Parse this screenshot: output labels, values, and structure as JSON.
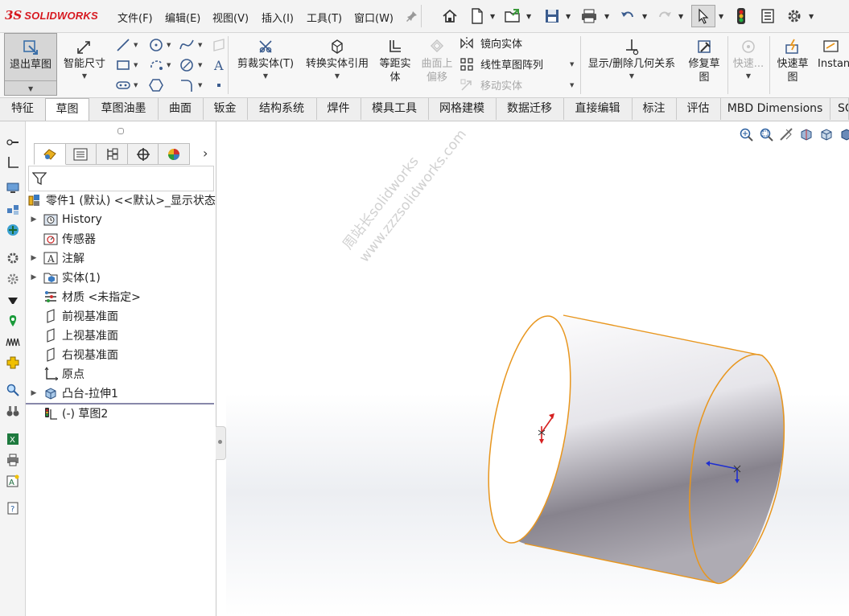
{
  "app": {
    "logo_ds": "3S",
    "logo_text": "SOLIDWORKS"
  },
  "menu": [
    "文件(F)",
    "编辑(E)",
    "视图(V)",
    "插入(I)",
    "工具(T)",
    "窗口(W)"
  ],
  "command_manager": {
    "exit_sketch": "退出草图",
    "smart_dimension": "智能尺寸",
    "trim_entities": "剪裁实体(T)",
    "convert_entities": "转换实体引用",
    "offset_entities_l1": "等距实",
    "offset_entities_l2": "体",
    "offset_on_surface_l1": "曲面上",
    "offset_on_surface_l2": "偏移",
    "mirror_entities": "镜向实体",
    "linear_pattern": "线性草图阵列",
    "move_entities": "移动实体",
    "display_relations": "显示/删除几何关系",
    "repair_sketch_l1": "修复草",
    "repair_sketch_l2": "图",
    "quick_snaps": "快速...",
    "rapid_sketch_l1": "快速草",
    "rapid_sketch_l2": "图",
    "instant2d": "Instan"
  },
  "tabs": [
    "特征",
    "草图",
    "草图油墨",
    "曲面",
    "钣金",
    "结构系统",
    "焊件",
    "模具工具",
    "网格建模",
    "数据迁移",
    "直接编辑",
    "标注",
    "评估",
    "MBD Dimensions",
    "SC"
  ],
  "active_tab": "草图",
  "feature_tree": {
    "root": "零件1 (默认) <<默认>_显示状态",
    "items": [
      {
        "label": "History",
        "expandable": true
      },
      {
        "label": "传感器",
        "expandable": false
      },
      {
        "label": "注解",
        "expandable": true
      },
      {
        "label": "实体(1)",
        "expandable": true
      },
      {
        "label": "材质 <未指定>",
        "expandable": false
      },
      {
        "label": "前视基准面",
        "expandable": false
      },
      {
        "label": "上视基准面",
        "expandable": false
      },
      {
        "label": "右视基准面",
        "expandable": false
      },
      {
        "label": "原点",
        "expandable": false
      },
      {
        "label": "凸台-拉伸1",
        "expandable": true
      },
      {
        "label": "(-) 草图2",
        "expandable": false
      }
    ]
  },
  "watermark": {
    "line1": "周站长solidworks",
    "line2": "www.zzzsolidworks.com"
  },
  "colors": {
    "accent": "#d71920",
    "edge": "#e8961e",
    "selected_button": "#d6d6d6"
  }
}
